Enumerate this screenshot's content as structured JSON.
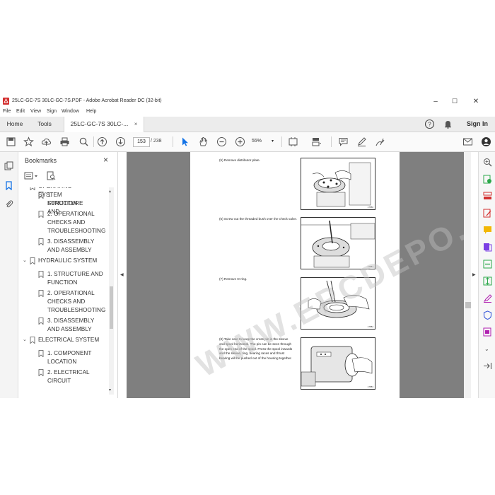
{
  "window": {
    "title": "25LC-GC-7S 30LC-GC-7S.PDF - Adobe Acrobat Reader DC (32-bit)",
    "min_label": "–",
    "max_label": "☐",
    "close_label": "✕"
  },
  "menu": {
    "items": [
      "File",
      "Edit",
      "View",
      "Sign",
      "Window",
      "Help"
    ]
  },
  "tabs": {
    "home": "Home",
    "tools": "Tools",
    "document": "25LC-GC-7S 30LC-...",
    "close": "×",
    "signin": "Sign In"
  },
  "toolbar": {
    "current_page": "153",
    "page_total": "/  238",
    "zoom": "55%"
  },
  "bookmarks": {
    "title": "Bookmarks",
    "close": "×",
    "items": [
      {
        "label": "OPERATING SYSTEM",
        "level": 0,
        "partial": true
      },
      {
        "label": "1. STRUCTURE AND",
        "label2": "FUNCTION",
        "level": 1
      },
      {
        "label": "2. OPERATIONAL",
        "label2": "CHECKS AND",
        "label3": "TROUBLESHOOTING",
        "level": 1
      },
      {
        "label": "3. DISASSEMBLY",
        "label2": "AND ASSEMBLY",
        "level": 1
      },
      {
        "label": "HYDRAULIC SYSTEM",
        "level": 0
      },
      {
        "label": "1. STRUCTURE AND",
        "label2": "FUNCTION",
        "level": 1
      },
      {
        "label": "2. OPERATIONAL",
        "label2": "CHECKS AND",
        "label3": "TROUBLESHOOTING",
        "level": 1
      },
      {
        "label": "3. DISASSEMBLY",
        "label2": "AND ASSEMBLY",
        "level": 1
      },
      {
        "label": "ELECTRICAL SYSTEM",
        "level": 0
      },
      {
        "label": "1. COMPONENT",
        "label2": "LOCATION",
        "level": 1
      },
      {
        "label": "2. ELECTRICAL",
        "label2": "CIRCUIT",
        "level": 1
      }
    ]
  },
  "document": {
    "steps": [
      {
        "text": "(5)  Remove distributor plate.",
        "fig": "17580"
      },
      {
        "text": "(6)  Screw out the threaded bush over the check valve.",
        "fig": "17581"
      },
      {
        "text": "(7)  Remove O-ring.",
        "fig": "17582"
      },
      {
        "text": "(8)  Take care to keep the cross pin in the sleeve and spool horizontal. The pin can be seen through the open end of the spool. Press the spool inwards and the sleeve, ring, bearing races and thrust bearing will be pushed out of the housing together.",
        "fig": "17583"
      }
    ],
    "watermark": "WWW.EPCDEPO.COM"
  },
  "colors": {
    "accent": "#1473e6",
    "pdf_red": "#d32f2f",
    "viewer_bg": "#7f7f7f"
  }
}
